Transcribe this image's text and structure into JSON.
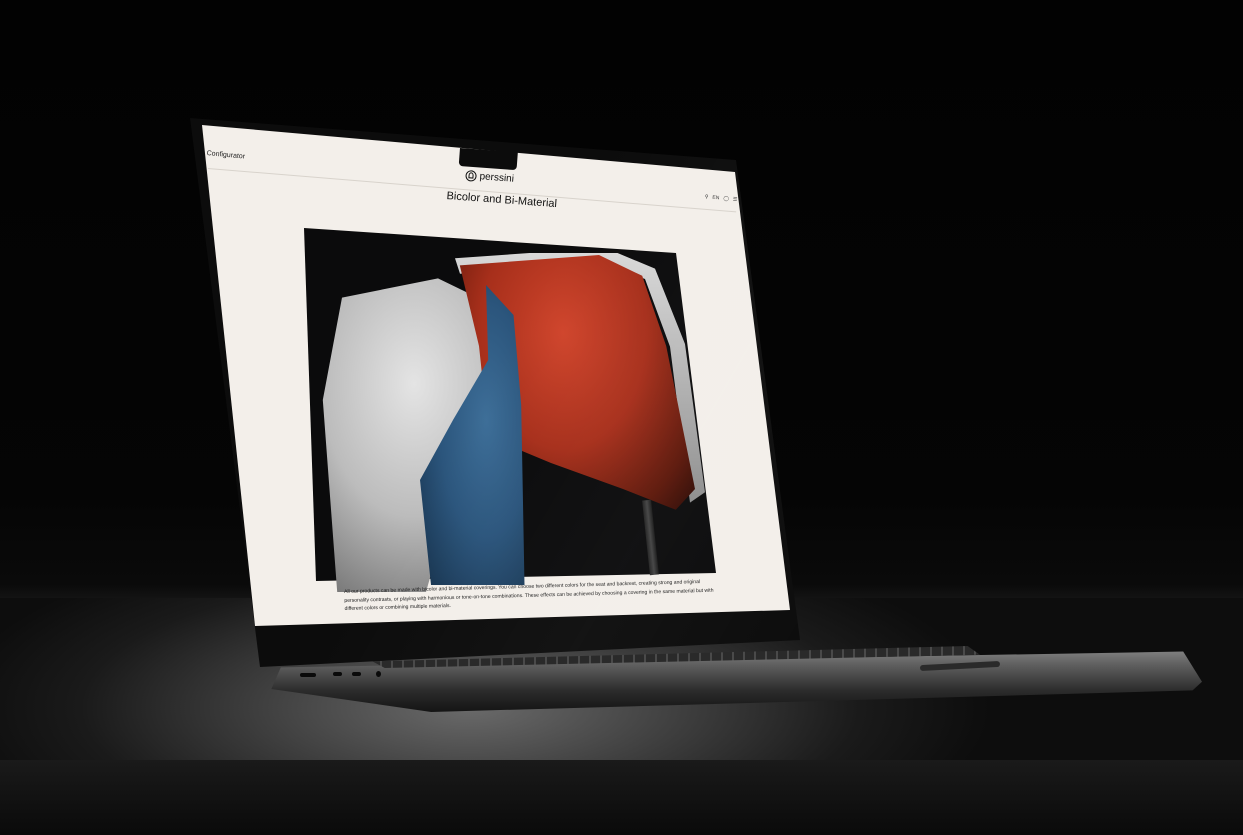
{
  "app": {
    "nav_label": "Configurator",
    "brand": "perssini",
    "page_title": "Bicolor and Bi-Material",
    "toolbar": {
      "language": "EN",
      "icons": [
        "search-icon",
        "language-label",
        "cart-icon",
        "menu-icon"
      ]
    }
  },
  "hero": {
    "image": "chair-bicolor-photo",
    "colors": {
      "white_chair": "#c8c8c8",
      "blue_chair": "#2f5d86",
      "red_chair": "#b8361f"
    }
  },
  "description": "All our products can be made with bicolor and bi-material coverings. You can choose two different colors for the seat and backrest, creating strong and original personality contrasts, or playing with harmonious or tone-on-tone combinations. These effects can be achieved by choosing a covering in the same material but with different colors or combining multiple materials."
}
